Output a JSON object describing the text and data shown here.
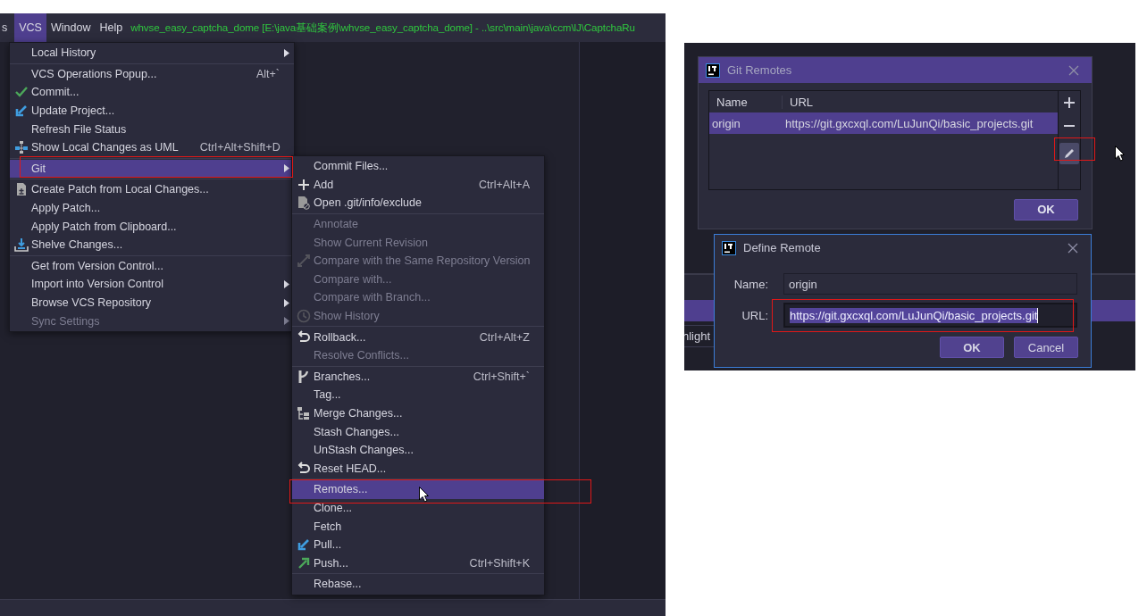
{
  "menubar": {
    "items": [
      {
        "label": "s",
        "selected": false
      },
      {
        "label": "VCS",
        "selected": true
      },
      {
        "label": "Window",
        "selected": false
      },
      {
        "label": "Help",
        "selected": false
      }
    ],
    "title": "whvse_easy_captcha_dome [E:\\java基础案例\\whvse_easy_captcha_dome] - ..\\src\\main\\java\\ccm\\lJ\\CaptchaRu"
  },
  "vcs_menu": {
    "items": [
      {
        "kind": "item",
        "label": "Local History",
        "submenu": true,
        "disabled": false,
        "selected": false
      },
      {
        "kind": "separator"
      },
      {
        "kind": "item",
        "label": "VCS Operations Popup...",
        "shortcut": "Alt+`",
        "submenu": false,
        "disabled": false,
        "selected": false
      },
      {
        "kind": "item",
        "label": "Commit...",
        "submenu": false,
        "disabled": false,
        "selected": false
      },
      {
        "kind": "item",
        "label": "Update Project...",
        "submenu": false,
        "disabled": false,
        "selected": false
      },
      {
        "kind": "item",
        "label": "Refresh File Status",
        "submenu": false,
        "disabled": false,
        "selected": false
      },
      {
        "kind": "item",
        "label": "Show Local Changes as UML",
        "shortcut": "Ctrl+Alt+Shift+D",
        "submenu": false,
        "disabled": false,
        "selected": false
      },
      {
        "kind": "separator"
      },
      {
        "kind": "item",
        "label": "Git",
        "submenu": true,
        "disabled": false,
        "selected": true
      },
      {
        "kind": "separator"
      },
      {
        "kind": "item",
        "label": "Create Patch from Local Changes...",
        "submenu": false,
        "disabled": false,
        "selected": false
      },
      {
        "kind": "item",
        "label": "Apply Patch...",
        "submenu": false,
        "disabled": false,
        "selected": false
      },
      {
        "kind": "item",
        "label": "Apply Patch from Clipboard...",
        "submenu": false,
        "disabled": false,
        "selected": false
      },
      {
        "kind": "item",
        "label": "Shelve Changes...",
        "submenu": false,
        "disabled": false,
        "selected": false
      },
      {
        "kind": "separator"
      },
      {
        "kind": "item",
        "label": "Get from Version Control...",
        "submenu": false,
        "disabled": false,
        "selected": false
      },
      {
        "kind": "item",
        "label": "Import into Version Control",
        "submenu": true,
        "disabled": false,
        "selected": false
      },
      {
        "kind": "item",
        "label": "Browse VCS Repository",
        "submenu": true,
        "disabled": false,
        "selected": false
      },
      {
        "kind": "item",
        "label": "Sync Settings",
        "submenu": true,
        "disabled": true,
        "selected": false
      }
    ]
  },
  "git_menu": {
    "items": [
      {
        "kind": "item",
        "label": "Commit Files...",
        "submenu": false,
        "disabled": false,
        "selected": false
      },
      {
        "kind": "item",
        "label": "Add",
        "shortcut": "Ctrl+Alt+A",
        "submenu": false,
        "disabled": false,
        "selected": false
      },
      {
        "kind": "item",
        "label": "Open .git/info/exclude",
        "submenu": false,
        "disabled": false,
        "selected": false
      },
      {
        "kind": "separator"
      },
      {
        "kind": "item",
        "label": "Annotate",
        "submenu": false,
        "disabled": true,
        "selected": false
      },
      {
        "kind": "item",
        "label": "Show Current Revision",
        "submenu": false,
        "disabled": true,
        "selected": false
      },
      {
        "kind": "item",
        "label": "Compare with the Same Repository Version",
        "submenu": false,
        "disabled": true,
        "selected": false
      },
      {
        "kind": "item",
        "label": "Compare with...",
        "submenu": false,
        "disabled": true,
        "selected": false
      },
      {
        "kind": "item",
        "label": "Compare with Branch...",
        "submenu": false,
        "disabled": true,
        "selected": false
      },
      {
        "kind": "item",
        "label": "Show History",
        "submenu": false,
        "disabled": true,
        "selected": false
      },
      {
        "kind": "separator"
      },
      {
        "kind": "item",
        "label": "Rollback...",
        "shortcut": "Ctrl+Alt+Z",
        "submenu": false,
        "disabled": false,
        "selected": false
      },
      {
        "kind": "item",
        "label": "Resolve Conflicts...",
        "submenu": false,
        "disabled": true,
        "selected": false
      },
      {
        "kind": "separator"
      },
      {
        "kind": "item",
        "label": "Branches...",
        "shortcut": "Ctrl+Shift+`",
        "submenu": false,
        "disabled": false,
        "selected": false
      },
      {
        "kind": "item",
        "label": "Tag...",
        "submenu": false,
        "disabled": false,
        "selected": false
      },
      {
        "kind": "item",
        "label": "Merge Changes...",
        "submenu": false,
        "disabled": false,
        "selected": false
      },
      {
        "kind": "item",
        "label": "Stash Changes...",
        "submenu": false,
        "disabled": false,
        "selected": false
      },
      {
        "kind": "item",
        "label": "UnStash Changes...",
        "submenu": false,
        "disabled": false,
        "selected": false
      },
      {
        "kind": "item",
        "label": "Reset HEAD...",
        "submenu": false,
        "disabled": false,
        "selected": false
      },
      {
        "kind": "separator"
      },
      {
        "kind": "item",
        "label": "Remotes...",
        "submenu": false,
        "disabled": false,
        "selected": true
      },
      {
        "kind": "item",
        "label": "Clone...",
        "submenu": false,
        "disabled": false,
        "selected": false
      },
      {
        "kind": "item",
        "label": "Fetch",
        "submenu": false,
        "disabled": false,
        "selected": false
      },
      {
        "kind": "item",
        "label": "Pull...",
        "submenu": false,
        "disabled": false,
        "selected": false
      },
      {
        "kind": "item",
        "label": "Push...",
        "shortcut": "Ctrl+Shift+K",
        "submenu": false,
        "disabled": false,
        "selected": false
      },
      {
        "kind": "separator"
      },
      {
        "kind": "item",
        "label": "Rebase...",
        "submenu": false,
        "disabled": false,
        "selected": false
      }
    ]
  },
  "git_remotes": {
    "title": "Git Remotes",
    "columns": [
      "Name",
      "URL"
    ],
    "rows": [
      {
        "name": "origin",
        "url": "https://git.gxcxql.com/LuJunQi/basic_projects.git",
        "selected": true
      }
    ],
    "buttons": [
      "OK"
    ]
  },
  "define_remote": {
    "title": "Define Remote",
    "fields": [
      {
        "label": "Name:",
        "value": "origin",
        "text_selected": false
      },
      {
        "label": "URL:",
        "value": "https://git.gxcxql.com/LuJunQi/basic_projects.git",
        "text_selected": true
      }
    ],
    "buttons": [
      {
        "label": "OK",
        "default": true
      },
      {
        "label": "Cancel",
        "default": false
      }
    ]
  },
  "background_text": "hlight"
}
